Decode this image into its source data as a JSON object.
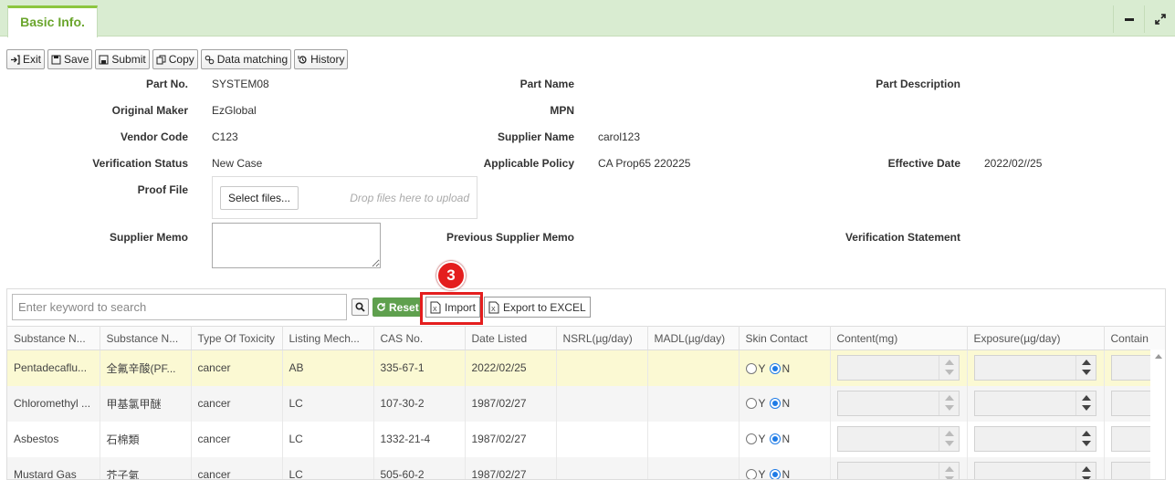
{
  "tab": {
    "label": "Basic Info."
  },
  "toolbar": {
    "exit": "Exit",
    "save": "Save",
    "submit": "Submit",
    "copy": "Copy",
    "data_matching": "Data matching",
    "history": "History"
  },
  "form": {
    "part_no_label": "Part No.",
    "part_no": "SYSTEM08",
    "part_name_label": "Part Name",
    "part_desc_label": "Part Description",
    "original_maker_label": "Original Maker",
    "original_maker": "EzGlobal",
    "mpn_label": "MPN",
    "vendor_code_label": "Vendor Code",
    "vendor_code": "C123",
    "supplier_name_label": "Supplier Name",
    "supplier_name": "carol123",
    "verification_status_label": "Verification Status",
    "verification_status": "New Case",
    "applicable_policy_label": "Applicable Policy",
    "applicable_policy": "CA Prop65 220225",
    "effective_date_label": "Effective Date",
    "effective_date": "2022/02//25",
    "proof_file_label": "Proof File",
    "select_files": "Select files...",
    "drop_hint": "Drop files here to upload",
    "supplier_memo_label": "Supplier Memo",
    "previous_supplier_memo_label": "Previous Supplier Memo",
    "verification_statement_label": "Verification Statement"
  },
  "grid": {
    "search_placeholder": "Enter keyword to search",
    "reset": "Reset",
    "import": "Import",
    "export": "Export to EXCEL",
    "step_badge": "3",
    "columns": [
      "Substance N...",
      "Substance N...",
      "Type Of Toxicity",
      "Listing Mech...",
      "CAS No.",
      "Date Listed",
      "NSRL(µg/day)",
      "MADL(µg/day)",
      "Skin Contact",
      "Content(mg)",
      "Exposure(µg/day)",
      "Contain"
    ],
    "radio_y": "Y",
    "radio_n": "N",
    "rows": [
      {
        "name_en": "Pentadecaflu...",
        "name_zh": "全氟辛酸(PF...",
        "toxicity": "cancer",
        "mechanism": "AB",
        "cas": "335-67-1",
        "date": "2022/02/25",
        "nsrl": "",
        "madl": ""
      },
      {
        "name_en": "Chloromethyl ...",
        "name_zh": "甲基氯甲醚",
        "toxicity": "cancer",
        "mechanism": "LC",
        "cas": "107-30-2",
        "date": "1987/02/27",
        "nsrl": "",
        "madl": ""
      },
      {
        "name_en": "Asbestos",
        "name_zh": "石棉類",
        "toxicity": "cancer",
        "mechanism": "LC",
        "cas": "1332-21-4",
        "date": "1987/02/27",
        "nsrl": "",
        "madl": ""
      },
      {
        "name_en": "Mustard Gas",
        "name_zh": "芥子氣",
        "toxicity": "cancer",
        "mechanism": "LC",
        "cas": "505-60-2",
        "date": "1987/02/27",
        "nsrl": "",
        "madl": ""
      }
    ]
  }
}
